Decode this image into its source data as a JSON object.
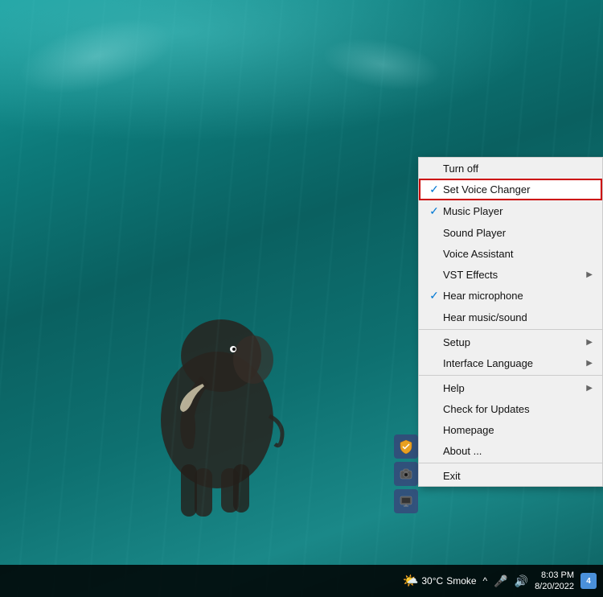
{
  "desktop": {
    "bg_description": "Underwater scene with elephant"
  },
  "context_menu": {
    "items": [
      {
        "id": "turn-off",
        "label": "Turn off",
        "check": "",
        "has_submenu": false,
        "highlighted": false,
        "separator_above": false
      },
      {
        "id": "set-voice-changer",
        "label": "Set Voice Changer",
        "check": "✓",
        "has_submenu": false,
        "highlighted": true,
        "separator_above": false
      },
      {
        "id": "music-player",
        "label": "Music Player",
        "check": "✓",
        "has_submenu": false,
        "highlighted": false,
        "separator_above": false
      },
      {
        "id": "sound-player",
        "label": "Sound Player",
        "check": "",
        "has_submenu": false,
        "highlighted": false,
        "separator_above": false
      },
      {
        "id": "voice-assistant",
        "label": "Voice Assistant",
        "check": "",
        "has_submenu": false,
        "highlighted": false,
        "separator_above": false
      },
      {
        "id": "vst-effects",
        "label": "VST Effects",
        "check": "",
        "has_submenu": true,
        "highlighted": false,
        "separator_above": false
      },
      {
        "id": "hear-microphone",
        "label": "Hear microphone",
        "check": "✓",
        "has_submenu": false,
        "highlighted": false,
        "separator_above": false
      },
      {
        "id": "hear-music",
        "label": "Hear music/sound",
        "check": "",
        "has_submenu": false,
        "highlighted": false,
        "separator_above": false
      },
      {
        "id": "setup",
        "label": "Setup",
        "check": "",
        "has_submenu": true,
        "highlighted": false,
        "separator_above": true
      },
      {
        "id": "interface-language",
        "label": "Interface Language",
        "check": "",
        "has_submenu": true,
        "highlighted": false,
        "separator_above": false
      },
      {
        "id": "help",
        "label": "Help",
        "check": "",
        "has_submenu": true,
        "highlighted": false,
        "separator_above": true
      },
      {
        "id": "check-updates",
        "label": "Check for Updates",
        "check": "",
        "has_submenu": false,
        "highlighted": false,
        "separator_above": false
      },
      {
        "id": "homepage",
        "label": "Homepage",
        "check": "",
        "has_submenu": false,
        "highlighted": false,
        "separator_above": false
      },
      {
        "id": "about",
        "label": "About ...",
        "check": "",
        "has_submenu": false,
        "highlighted": false,
        "separator_above": false
      },
      {
        "id": "exit",
        "label": "Exit",
        "check": "",
        "has_submenu": false,
        "highlighted": false,
        "separator_above": true
      }
    ]
  },
  "taskbar": {
    "weather_icon": "🌤️",
    "temperature": "30°C",
    "condition": "Smoke",
    "time": "8:03 PM",
    "date": "8/20/2022",
    "notification_count": "4",
    "expand_label": "^"
  },
  "tray": {
    "items": [
      {
        "id": "shield-icon",
        "symbol": "🛡"
      },
      {
        "id": "camera-icon",
        "symbol": "📷"
      },
      {
        "id": "screen-icon",
        "symbol": "🖥"
      }
    ]
  }
}
